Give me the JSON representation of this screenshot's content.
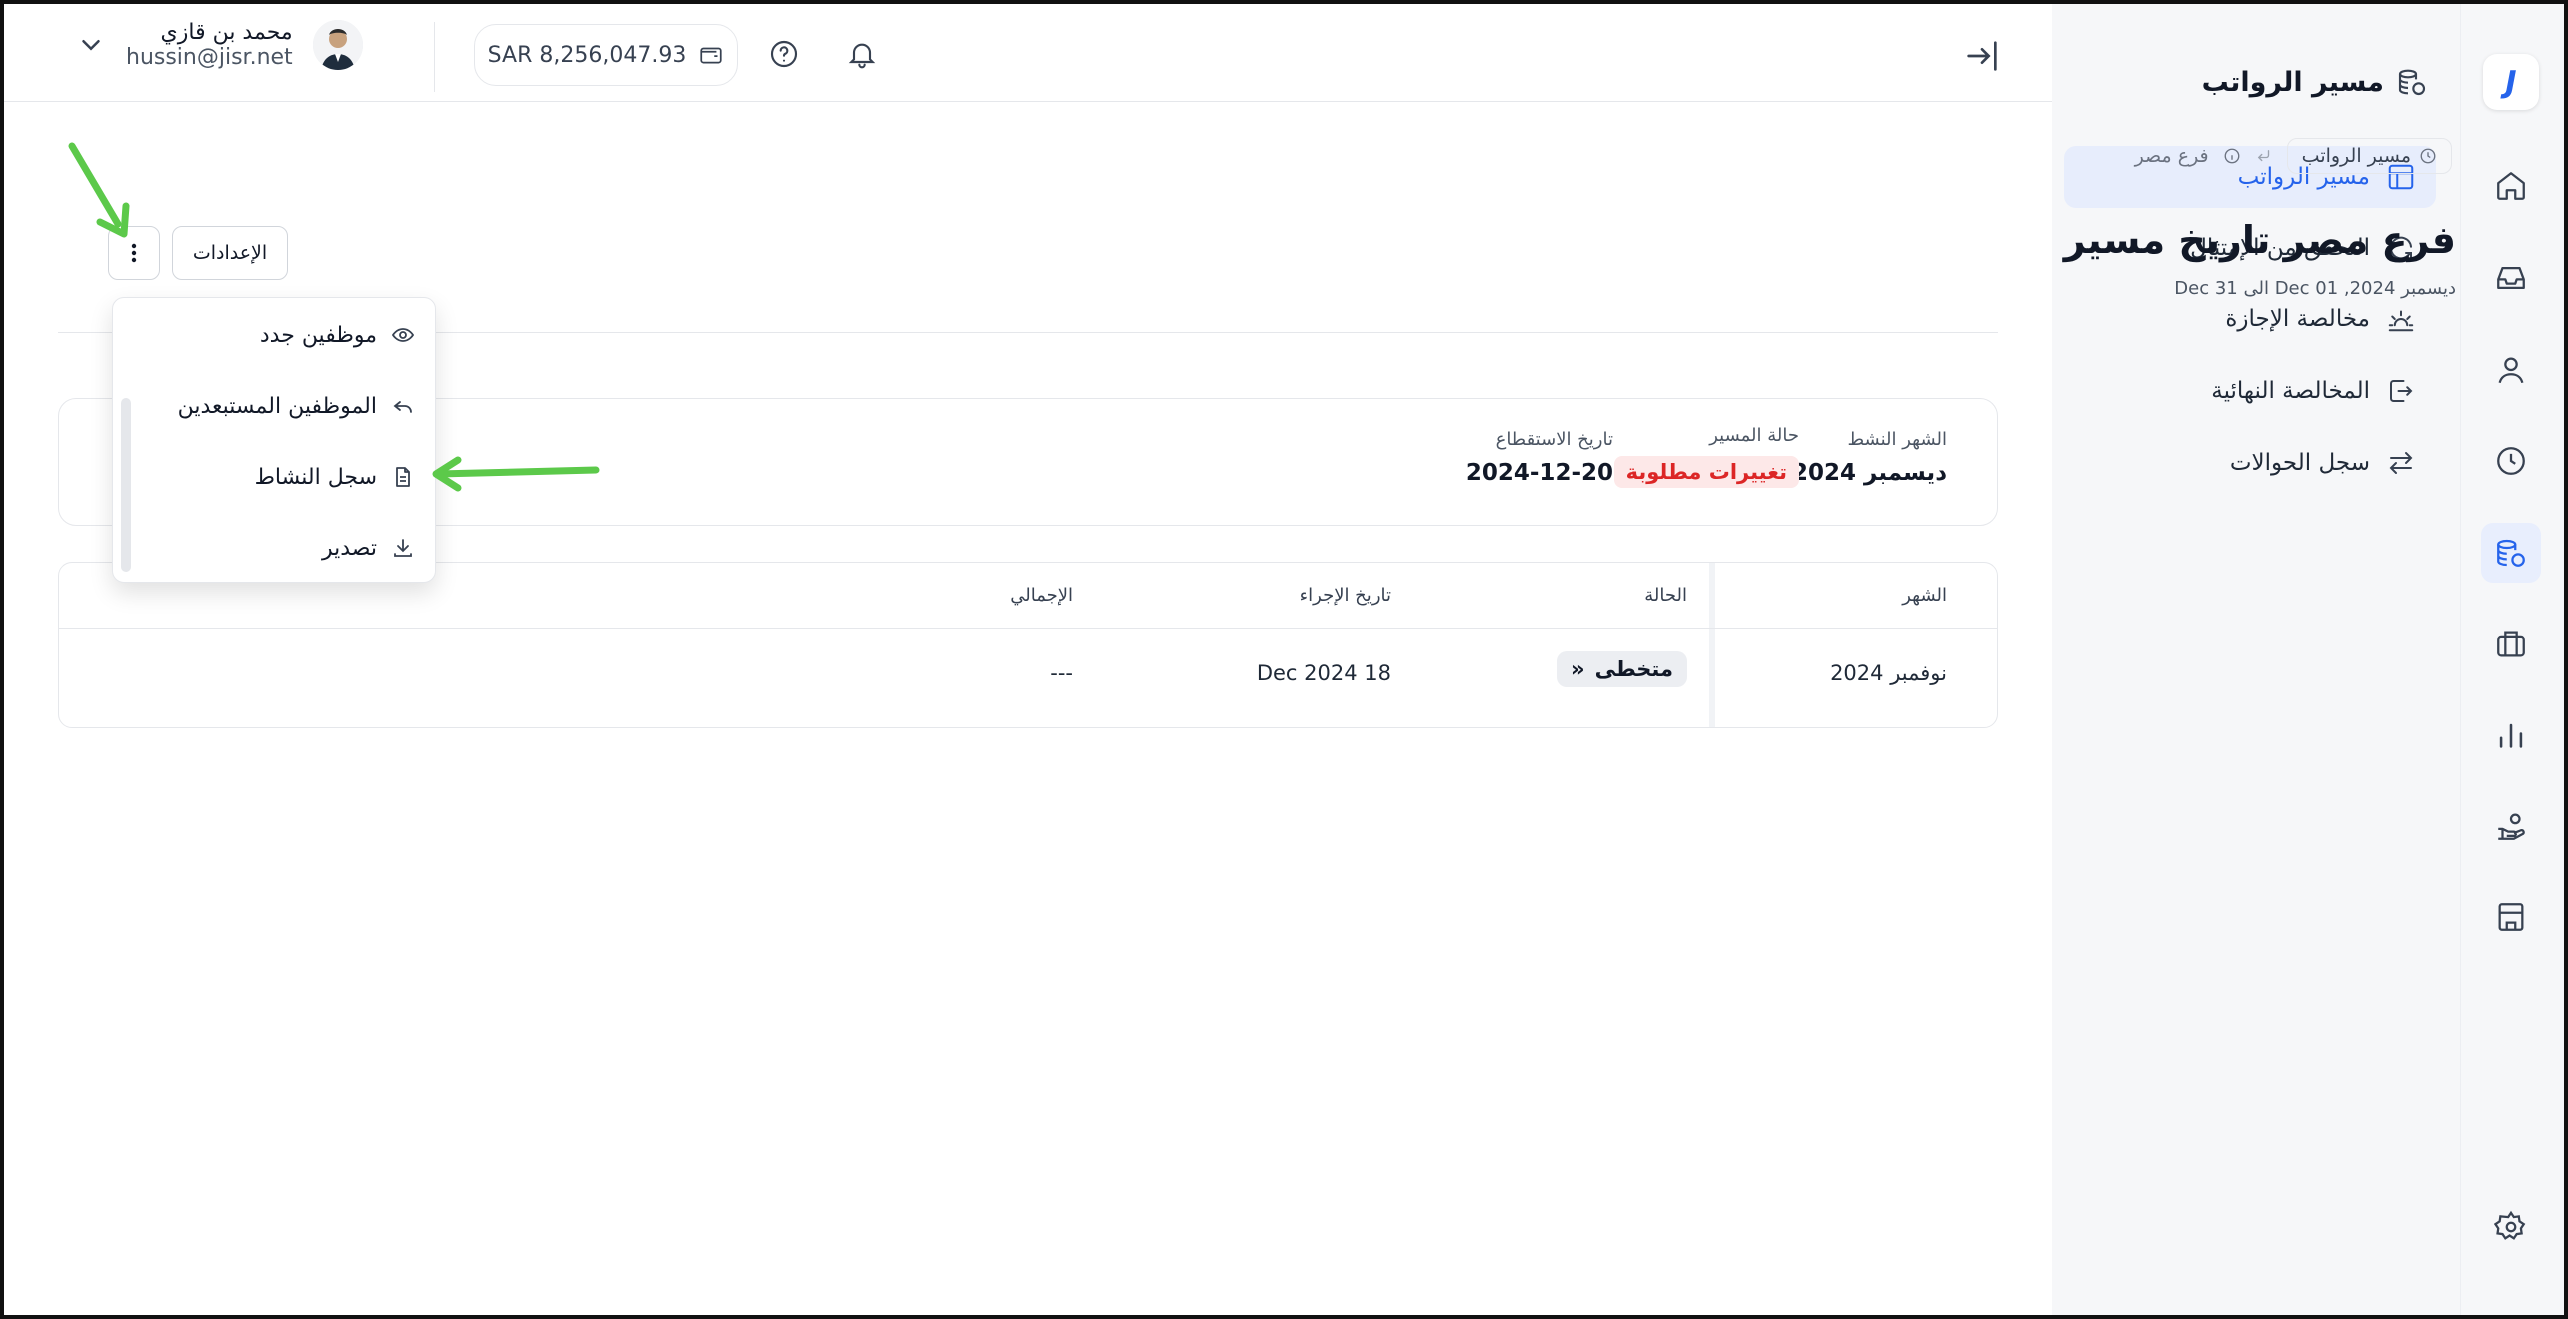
{
  "app": {
    "sidebar_title": "مسير الرواتب",
    "brand_letter": "J"
  },
  "sidebar": {
    "items": [
      {
        "label": "مسير الرواتب",
        "active": true,
        "icon": "table-icon"
      },
      {
        "label": "التحقق من الإمتثال",
        "active": false,
        "icon": "refresh-icon"
      },
      {
        "label": "مخالصة الإجازة",
        "active": false,
        "icon": "sunset-icon"
      },
      {
        "label": "المخالصة النهائية",
        "active": false,
        "icon": "exit-icon"
      },
      {
        "label": "سجل الحوالات",
        "active": false,
        "icon": "swap-icon"
      }
    ]
  },
  "rail": {
    "icons": [
      "home-icon",
      "inbox-icon",
      "user-icon",
      "clock-icon",
      "coins-icon",
      "briefcase-icon",
      "chart-icon",
      "hand-coins-icon",
      "building-icon",
      "settings-icon"
    ],
    "active": "coins-icon"
  },
  "header": {
    "user_name": "محمد بن قازي",
    "user_email": "hussin@jisr.net",
    "balance": "SAR 8,256,047.93"
  },
  "breadcrumb": {
    "parent": "مسير الرواتب",
    "current": "فرع مصر"
  },
  "page": {
    "title": "فرع مصر تاريخ مسير",
    "subtitle": "ديسمبر 2024, Dec 01 الى Dec 31",
    "settings_label": "الإعدادات"
  },
  "summary": {
    "active_month_label": "الشهر النشط",
    "active_month_value": "ديسمبر 2024",
    "status_label": "حالة المسير",
    "status_value": "تغييرات مطلوبة",
    "deduction_label": "تاريخ الاستقطاع",
    "deduction_value": "2024-12-20"
  },
  "table": {
    "headers": {
      "month": "الشهر",
      "status": "الحالة",
      "action_date": "تاريخ الإجراء",
      "total": "الإجمالي"
    },
    "rows": [
      {
        "month": "نوفمبر 2024",
        "status": "متخطى",
        "action_date": "Dec 2024 18",
        "total": "---"
      }
    ]
  },
  "menu": {
    "items": [
      {
        "label": "موظفين جدد",
        "icon": "eye-icon"
      },
      {
        "label": "الموظفين المستبعدين",
        "icon": "reply-icon"
      },
      {
        "label": "سجل النشاط",
        "icon": "file-text-icon"
      },
      {
        "label": "تصدير",
        "icon": "download-icon"
      }
    ]
  },
  "colors": {
    "accent": "#2563eb",
    "annotation_arrow": "#5cc94a",
    "status_red": "#dc2626"
  }
}
